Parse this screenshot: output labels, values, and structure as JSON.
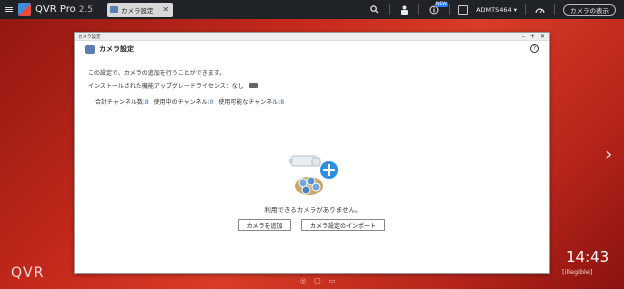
{
  "app": {
    "name": "QVR Pro",
    "version": "2.5"
  },
  "tab": {
    "label": "カメラ設定",
    "close": "✕"
  },
  "topbar": {
    "badge": "NEW",
    "user": "ADMTS464 ▾",
    "show_cameras": "カメラの表示"
  },
  "window": {
    "titlebar": "カメラ設定",
    "controls": [
      "–",
      "+",
      "✕"
    ],
    "title": "カメラ設定",
    "help": "?",
    "description": "この設定で、カメラの追加を行うことができます。",
    "license": "インストールされた機能アップグレードライセンス：なし",
    "stats": {
      "total_label": "合計チャンネル数:",
      "total_value": "8",
      "used_label": "使用中のチャンネル:",
      "used_value": "0",
      "available_label": "使用可能なチャンネル:",
      "available_value": "8"
    },
    "empty_message": "利用できるカメラがありません。",
    "buttons": {
      "add": "カメラを追加",
      "import": "カメラ設定のインポート"
    }
  },
  "desktop": {
    "clock": "14:43",
    "date": "[illegible]",
    "brand": "QVR",
    "next_arrow": "›"
  },
  "colors": {
    "accent": "#2d7ff9",
    "topbar": "#1f2226",
    "desktop": "#c4291c"
  }
}
